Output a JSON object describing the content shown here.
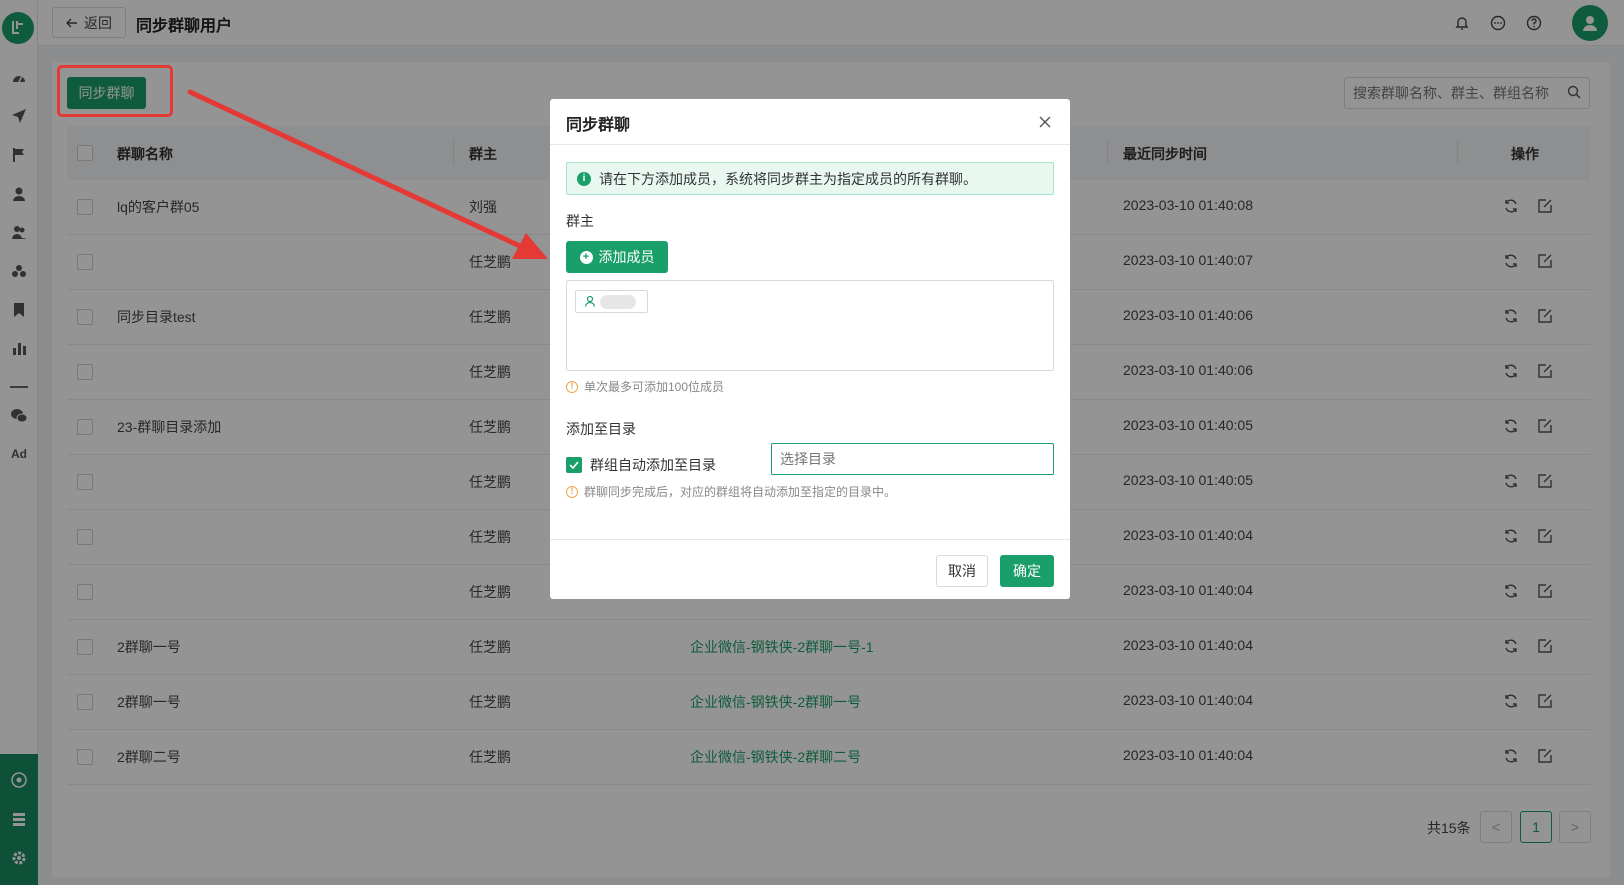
{
  "header": {
    "back_label": "返回",
    "title": "同步群聊用户"
  },
  "sidebar": {
    "ad_label": "Ad"
  },
  "toolbar": {
    "sync_label": "同步群聊",
    "search_placeholder": "搜索群聊名称、群主、群组名称"
  },
  "table": {
    "columns": [
      "群聊名称",
      "群主",
      "最近同步时间",
      "操作"
    ],
    "rows": [
      {
        "name": "lq的客户群05",
        "owner": "刘强",
        "group": "",
        "time": "2023-03-10 01:40:08"
      },
      {
        "name": "",
        "owner": "任芝鹏",
        "group": "",
        "time": "2023-03-10 01:40:07"
      },
      {
        "name": "同步目录test",
        "owner": "任芝鹏",
        "group": "",
        "time": "2023-03-10 01:40:06"
      },
      {
        "name": "",
        "owner": "任芝鹏",
        "group": "",
        "time": "2023-03-10 01:40:06"
      },
      {
        "name": "23-群聊目录添加",
        "owner": "任芝鹏",
        "group": "",
        "time": "2023-03-10 01:40:05"
      },
      {
        "name": "",
        "owner": "任芝鹏",
        "group": "",
        "time": "2023-03-10 01:40:05"
      },
      {
        "name": "",
        "owner": "任芝鹏",
        "group": "",
        "time": "2023-03-10 01:40:04"
      },
      {
        "name": "",
        "owner": "任芝鹏",
        "group": "",
        "time": "2023-03-10 01:40:04"
      },
      {
        "name": "2群聊一号",
        "owner": "任芝鹏",
        "group": "企业微信-钢铁侠-2群聊一号-1",
        "time": "2023-03-10 01:40:04"
      },
      {
        "name": "2群聊一号",
        "owner": "任芝鹏",
        "group": "企业微信-钢铁侠-2群聊一号",
        "time": "2023-03-10 01:40:04"
      },
      {
        "name": "2群聊二号",
        "owner": "任芝鹏",
        "group": "企业微信-钢铁侠-2群聊二号",
        "time": "2023-03-10 01:40:04"
      }
    ]
  },
  "pagination": {
    "total": "共15条",
    "current_page": "1",
    "prev": "<",
    "next": ">"
  },
  "modal": {
    "title": "同步群聊",
    "info": "请在下方添加成员，系统将同步群主为指定成员的所有群聊。",
    "owner_label": "群主",
    "add_member_label": "添加成员",
    "member_hint": "单次最多可添加100位成员",
    "dir_label": "添加至目录",
    "auto_add_label": "群组自动添加至目录",
    "dir_placeholder": "选择目录",
    "dir_hint": "群聊同步完成后，对应的群组将自动添加至指定的目录中。",
    "cancel_label": "取消",
    "ok_label": "确定"
  },
  "colors": {
    "brand": "#1a9e6a",
    "annotation": "#e53935"
  }
}
